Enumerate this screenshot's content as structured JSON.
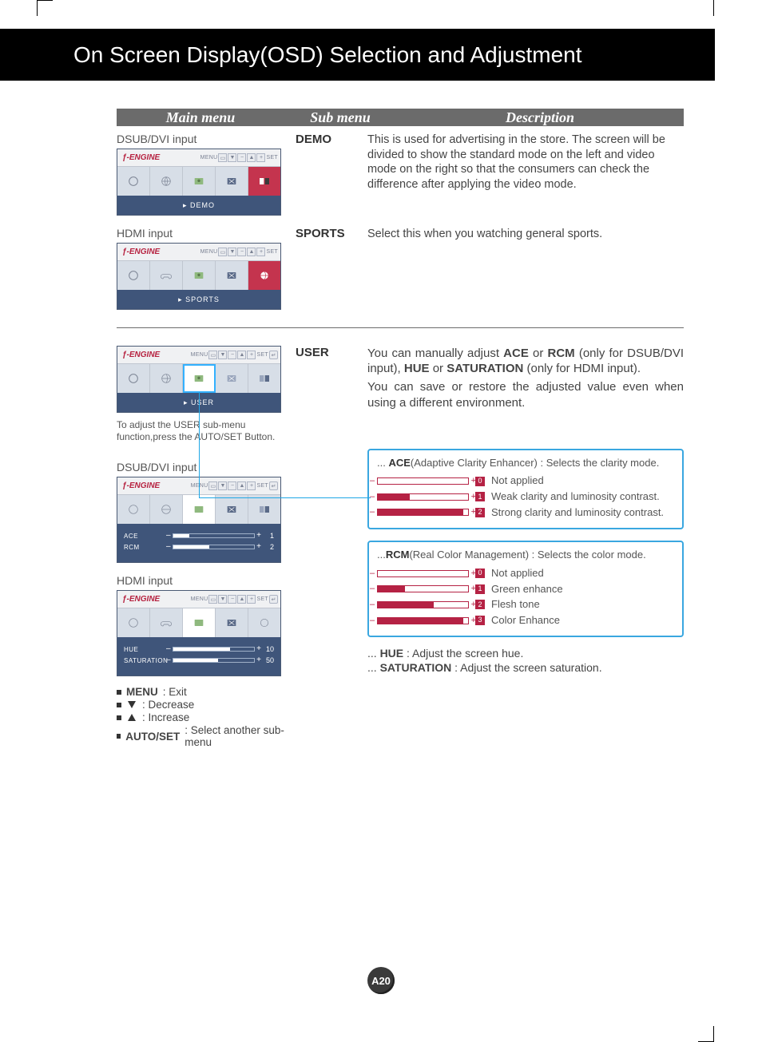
{
  "title": "On Screen Display(OSD) Selection and Adjustment",
  "table_head": {
    "main": "Main menu",
    "sub": "Sub menu",
    "desc": "Description"
  },
  "labels": {
    "dsub": "DSUB/DVI input",
    "hdmi": "HDMI input",
    "user_note": "To adjust the USER sub-menu function,press the AUTO/SET Button."
  },
  "osd": {
    "brand": "ƒ-ENGINE",
    "menu_lbl": "MENU",
    "set_lbl": "SET",
    "demo_footer": "▸ DEMO",
    "sports_footer": "▸ SPORTS",
    "user_footer": "▸ USER",
    "sliders_dsub": [
      {
        "label": "ACE",
        "value": "1",
        "fill": 20
      },
      {
        "label": "RCM",
        "value": "2",
        "fill": 45
      }
    ],
    "sliders_hdmi": [
      {
        "label": "HUE",
        "value": "10",
        "fill": 70
      },
      {
        "label": "SATURATION",
        "value": "50",
        "fill": 55
      }
    ]
  },
  "rows": {
    "demo": {
      "sub": "DEMO",
      "desc": "This is used for advertising in the store. The screen will be divided to show the standard mode on the left and video mode on the right so that the consumers can check the difference after applying the video mode."
    },
    "sports": {
      "sub": "SPORTS",
      "desc": "Select this when you watching general sports."
    },
    "user": {
      "sub": "USER",
      "desc1_a": "You can manually adjust ",
      "desc1_b": "ACE",
      "desc1_c": " or ",
      "desc1_d": "RCM",
      "desc1_e": " (only for DSUB/DVI input), ",
      "desc1_f": "HUE",
      "desc1_g": " or ",
      "desc1_h": "SATURATION",
      "desc1_i": " (only for HDMI input).",
      "desc2": "You can save or restore the adjusted value even when using a different environment."
    }
  },
  "ace_box": {
    "title_pre": "... ",
    "title_b": "ACE",
    "title_rest": "(Adaptive Clarity Enhancer) : Selects the clarity mode.",
    "opts": [
      {
        "n": "0",
        "fill": 0,
        "txt": "Not applied"
      },
      {
        "n": "1",
        "fill": 35,
        "txt": "Weak clarity and luminosity contrast."
      },
      {
        "n": "2",
        "fill": 95,
        "txt": "Strong clarity and luminosity contrast."
      }
    ]
  },
  "rcm_box": {
    "title_pre": "...",
    "title_b": "RCM",
    "title_rest": "(Real Color Management) : Selects the color mode.",
    "opts": [
      {
        "n": "0",
        "fill": 0,
        "txt": "Not applied"
      },
      {
        "n": "1",
        "fill": 30,
        "txt": "Green enhance"
      },
      {
        "n": "2",
        "fill": 62,
        "txt": "Flesh tone"
      },
      {
        "n": "3",
        "fill": 95,
        "txt": "Color Enhance"
      }
    ]
  },
  "hue_line_a": "... ",
  "hue_line_b": "HUE",
  "hue_line_c": " : Adjust the screen hue.",
  "sat_line_a": "... ",
  "sat_line_b": "SATURATION",
  "sat_line_c": " : Adjust the screen saturation.",
  "legend": {
    "menu_b": "MENU",
    "menu_t": " : Exit",
    "dec": " : Decrease",
    "inc": " : Increase",
    "auto_b": "AUTO/SET",
    "auto_t": " : Select another sub-menu"
  },
  "page_num": "A20"
}
